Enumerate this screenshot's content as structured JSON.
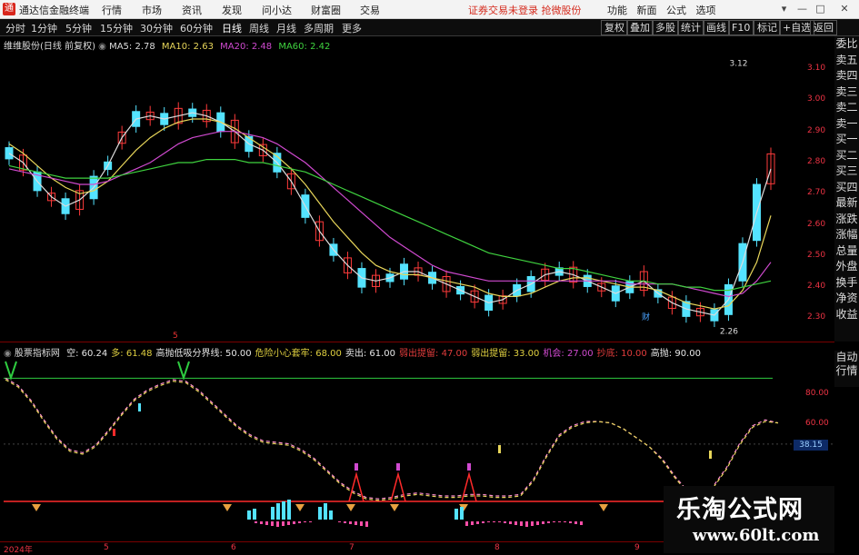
{
  "titlebar": {
    "logo": "通",
    "app_name": "通达信金融终端",
    "menus": [
      "行情",
      "市场",
      "资讯",
      "发现",
      "问小达",
      "财富圈",
      "交易"
    ],
    "notice": "证券交易未登录 抢微股份",
    "tools": [
      "功能",
      "新面",
      "公式",
      "选项"
    ],
    "window_buttons": [
      "▾",
      "—",
      "□",
      "✕"
    ]
  },
  "toolbar": {
    "periods": [
      "分时",
      "1分钟",
      "5分钟",
      "15分钟",
      "30分钟",
      "60分钟",
      "日线",
      "周线",
      "月线",
      "多周期",
      "更多"
    ],
    "selected_period": "日线",
    "right_buttons": [
      "复权",
      "叠加",
      "多股",
      "统计",
      "画线",
      "F10",
      "标记",
      "+自选",
      "返回"
    ]
  },
  "main_chart": {
    "title": "维维股份(日线 前复权)",
    "ma_legend": [
      {
        "label": "MA5: 2.78",
        "color": "#dddddd"
      },
      {
        "label": "MA10: 2.63",
        "color": "#e8d65a"
      },
      {
        "label": "MA20: 2.48",
        "color": "#d04ad0"
      },
      {
        "label": "MA60: 2.42",
        "color": "#3fd23f"
      }
    ],
    "price_axis": [
      "3.10",
      "3.00",
      "2.90",
      "2.80",
      "2.70",
      "2.60",
      "2.50",
      "2.40",
      "2.30"
    ],
    "high_label": "3.12",
    "low_label": "2.26",
    "marker_labels": [
      {
        "text": "5",
        "color": "#e33"
      },
      {
        "text": "财",
        "color": "#4aa3ff"
      }
    ]
  },
  "side_labels": [
    "委比",
    "卖五",
    "卖四",
    "卖三",
    "卖二",
    "卖一",
    "买一",
    "买二",
    "买三",
    "买四",
    "最新",
    "涨跌",
    "涨幅",
    "总量",
    "外盘",
    "换手",
    "净资",
    "收益"
  ],
  "indicator": {
    "name": "股票指标网",
    "items": [
      {
        "text": "空: 60.24",
        "color": "#e8e8e8"
      },
      {
        "text": "多: 61.48",
        "color": "#e0d040"
      },
      {
        "text": "高抛低吸分界线: 50.00",
        "color": "#e8e8e8"
      },
      {
        "text": "危险小心套牢: 68.00",
        "color": "#e0d040"
      },
      {
        "text": "卖出: 61.00",
        "color": "#e8e8e8"
      },
      {
        "text": "弱出提留: 47.00",
        "color": "#e23c3c"
      },
      {
        "text": "弱出提留: 33.00",
        "color": "#e0d040"
      },
      {
        "text": "机会: 27.00",
        "color": "#d04ad0"
      },
      {
        "text": "抄底: 10.00",
        "color": "#e23c3c"
      },
      {
        "text": "高抛: 90.00",
        "color": "#e8e8e8"
      }
    ],
    "axis": [
      "80.00",
      "60.00"
    ],
    "current_value": "38.15",
    "side_buttons": [
      "自动",
      "行情"
    ]
  },
  "dates": [
    "2024年",
    "5",
    "6",
    "7",
    "8",
    "9"
  ],
  "watermark": {
    "title": "乐淘公式网",
    "url": "www.60lt.com"
  },
  "chart_data": [
    {
      "type": "candlestick",
      "title": "维维股份(日线 前复权)",
      "ylim": [
        2.24,
        3.15
      ],
      "x_ticks": [
        "2024年",
        "5",
        "6",
        "7",
        "8",
        "9"
      ],
      "series": [
        {
          "name": "MA5",
          "values": [
            2.83,
            2.8,
            2.74,
            2.69,
            2.66,
            2.68,
            2.72,
            2.79,
            2.88,
            2.94,
            2.95,
            2.94,
            2.95,
            2.96,
            2.95,
            2.93,
            2.9,
            2.86,
            2.84,
            2.8,
            2.74,
            2.66,
            2.58,
            2.52,
            2.47,
            2.43,
            2.42,
            2.43,
            2.45,
            2.45,
            2.43,
            2.41,
            2.39,
            2.37,
            2.35,
            2.36,
            2.39,
            2.41,
            2.44,
            2.45,
            2.44,
            2.42,
            2.4,
            2.38,
            2.4,
            2.42,
            2.38,
            2.35,
            2.33,
            2.32,
            2.31,
            2.36,
            2.48,
            2.64,
            2.78
          ]
        },
        {
          "name": "MA10",
          "values": [
            2.86,
            2.83,
            2.79,
            2.75,
            2.72,
            2.7,
            2.71,
            2.74,
            2.79,
            2.84,
            2.88,
            2.91,
            2.93,
            2.94,
            2.94,
            2.93,
            2.91,
            2.88,
            2.85,
            2.82,
            2.78,
            2.73,
            2.67,
            2.61,
            2.56,
            2.51,
            2.47,
            2.45,
            2.44,
            2.44,
            2.43,
            2.42,
            2.41,
            2.4,
            2.38,
            2.37,
            2.37,
            2.38,
            2.4,
            2.42,
            2.43,
            2.43,
            2.42,
            2.41,
            2.4,
            2.4,
            2.39,
            2.37,
            2.35,
            2.34,
            2.33,
            2.34,
            2.39,
            2.48,
            2.63
          ]
        },
        {
          "name": "MA20",
          "values": [
            2.78,
            2.77,
            2.76,
            2.75,
            2.74,
            2.73,
            2.73,
            2.74,
            2.76,
            2.78,
            2.8,
            2.83,
            2.86,
            2.88,
            2.89,
            2.9,
            2.9,
            2.89,
            2.88,
            2.86,
            2.83,
            2.8,
            2.76,
            2.72,
            2.68,
            2.64,
            2.6,
            2.56,
            2.53,
            2.5,
            2.47,
            2.45,
            2.44,
            2.43,
            2.42,
            2.42,
            2.42,
            2.42,
            2.42,
            2.42,
            2.42,
            2.42,
            2.42,
            2.42,
            2.41,
            2.41,
            2.41,
            2.41,
            2.4,
            2.39,
            2.38,
            2.37,
            2.38,
            2.42,
            2.48
          ]
        },
        {
          "name": "MA60",
          "values": [
            2.79,
            2.78,
            2.77,
            2.76,
            2.75,
            2.75,
            2.75,
            2.75,
            2.76,
            2.77,
            2.78,
            2.79,
            2.8,
            2.8,
            2.81,
            2.81,
            2.81,
            2.8,
            2.8,
            2.79,
            2.78,
            2.77,
            2.75,
            2.73,
            2.71,
            2.69,
            2.67,
            2.65,
            2.63,
            2.61,
            2.59,
            2.57,
            2.55,
            2.53,
            2.51,
            2.5,
            2.49,
            2.48,
            2.47,
            2.46,
            2.46,
            2.45,
            2.44,
            2.43,
            2.42,
            2.42,
            2.41,
            2.41,
            2.4,
            2.4,
            2.39,
            2.39,
            2.4,
            2.41,
            2.42
          ]
        }
      ],
      "annotations": [
        "3.12",
        "2.26"
      ]
    },
    {
      "type": "line",
      "title": "股票指标网",
      "ylim": [
        0,
        100
      ],
      "series": [
        {
          "name": "空",
          "values": [
            90,
            85,
            75,
            62,
            50,
            42,
            40,
            45,
            55,
            66,
            76,
            82,
            86,
            89,
            88,
            82,
            74,
            66,
            58,
            52,
            48,
            47,
            46,
            42,
            36,
            28,
            20,
            14,
            10,
            9,
            10,
            12,
            13,
            12,
            11,
            11,
            12,
            12,
            11,
            11,
            12,
            22,
            38,
            52,
            58,
            61,
            61,
            60,
            56,
            50,
            44,
            36,
            24,
            14,
            12,
            18,
            30,
            46,
            58,
            62,
            60
          ]
        },
        {
          "name": "多",
          "values": [
            89,
            84,
            74,
            61,
            49,
            41,
            39,
            44,
            54,
            65,
            75,
            81,
            85,
            88,
            87,
            81,
            73,
            65,
            57,
            51,
            47,
            46,
            45,
            41,
            35,
            27,
            19,
            13,
            9,
            8,
            9,
            11,
            12,
            11,
            10,
            10,
            11,
            11,
            10,
            10,
            11,
            21,
            37,
            51,
            57,
            60,
            61,
            60,
            56,
            50,
            44,
            35,
            23,
            13,
            11,
            17,
            29,
            45,
            57,
            61,
            60
          ]
        }
      ],
      "levels": [
        90,
        68,
        61,
        50,
        47,
        33,
        27,
        10
      ]
    }
  ]
}
